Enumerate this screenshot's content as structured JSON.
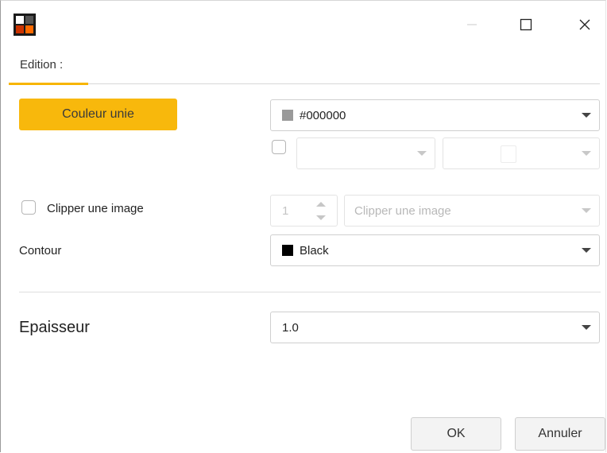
{
  "window": {
    "controls": {
      "minimize": "minimize-icon",
      "maximize": "maximize-icon",
      "close": "close-icon"
    }
  },
  "tabs": [
    {
      "label": "Edition :",
      "active": true
    }
  ],
  "fill": {
    "mode_button": "Couleur unie",
    "color_combo": {
      "value": "#000000",
      "swatch_color": "#9a9a9a"
    },
    "secondary_combo_1": {
      "value": ""
    },
    "secondary_combo_2": {
      "value": ""
    }
  },
  "clip": {
    "checkbox_label": "Clipper une image",
    "spin_value": "1",
    "combo_placeholder": "Clipper une image"
  },
  "contour": {
    "label": "Contour",
    "value": "Black",
    "swatch_color": "#000000"
  },
  "thickness": {
    "label": "Epaisseur",
    "value": "1.0"
  },
  "footer": {
    "ok_label": "OK",
    "cancel_label": "Annuler"
  },
  "colors": {
    "accent": "#f8b80c"
  }
}
